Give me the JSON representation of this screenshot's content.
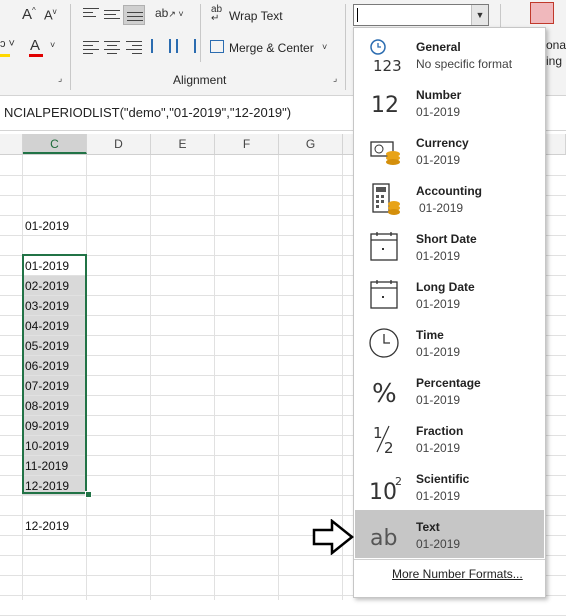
{
  "ribbon": {
    "font_grow": "A",
    "font_shrink": "A",
    "font_color_letter": "A",
    "wrap_text_label": "Wrap Text",
    "wrap_text_icon_text": "ab",
    "merge_center_label": "Merge & Center",
    "alignment_group_label": "Alignment",
    "right_fragment_1": "ona",
    "right_fragment_2": "ing",
    "font_color_swatch": "#e00000"
  },
  "formula_bar": {
    "text": "NCIALPERIODLIST(\"demo\",\"01-2019\",\"12-2019\")"
  },
  "columns": [
    "C",
    "D",
    "E",
    "F",
    "G"
  ],
  "cells": {
    "header_value": "01-2019",
    "list": [
      "01-2019",
      "02-2019",
      "03-2019",
      "04-2019",
      "05-2019",
      "06-2019",
      "07-2019",
      "08-2019",
      "09-2019",
      "10-2019",
      "11-2019",
      "12-2019"
    ],
    "footer_value": "12-2019"
  },
  "number_format_dropdown": {
    "current_value": "",
    "options": [
      {
        "name": "General",
        "sample": "No specific format",
        "icon": "general-123-icon"
      },
      {
        "name": "Number",
        "sample": "01-2019",
        "icon": "number-12-icon"
      },
      {
        "name": "Currency",
        "sample": "01-2019",
        "icon": "currency-icon"
      },
      {
        "name": "Accounting",
        "sample": "01-2019",
        "icon": "accounting-icon"
      },
      {
        "name": "Short Date",
        "sample": "01-2019",
        "icon": "short-date-calendar-icon"
      },
      {
        "name": "Long Date",
        "sample": "01-2019",
        "icon": "long-date-calendar-icon"
      },
      {
        "name": "Time",
        "sample": "01-2019",
        "icon": "clock-icon"
      },
      {
        "name": "Percentage",
        "sample": "01-2019",
        "icon": "percent-icon"
      },
      {
        "name": "Fraction",
        "sample": "01-2019",
        "icon": "fraction-icon"
      },
      {
        "name": "Scientific",
        "sample": "01-2019",
        "icon": "scientific-icon"
      },
      {
        "name": "Text",
        "sample": "01-2019",
        "icon": "text-ab-icon"
      }
    ],
    "selected": "Text",
    "more_formats_label": "More Number Formats..."
  },
  "colors": {
    "selection_border": "#217346",
    "selected_cell_fill": "#d9d9d9",
    "menu_highlight": "#c6c6c6"
  }
}
